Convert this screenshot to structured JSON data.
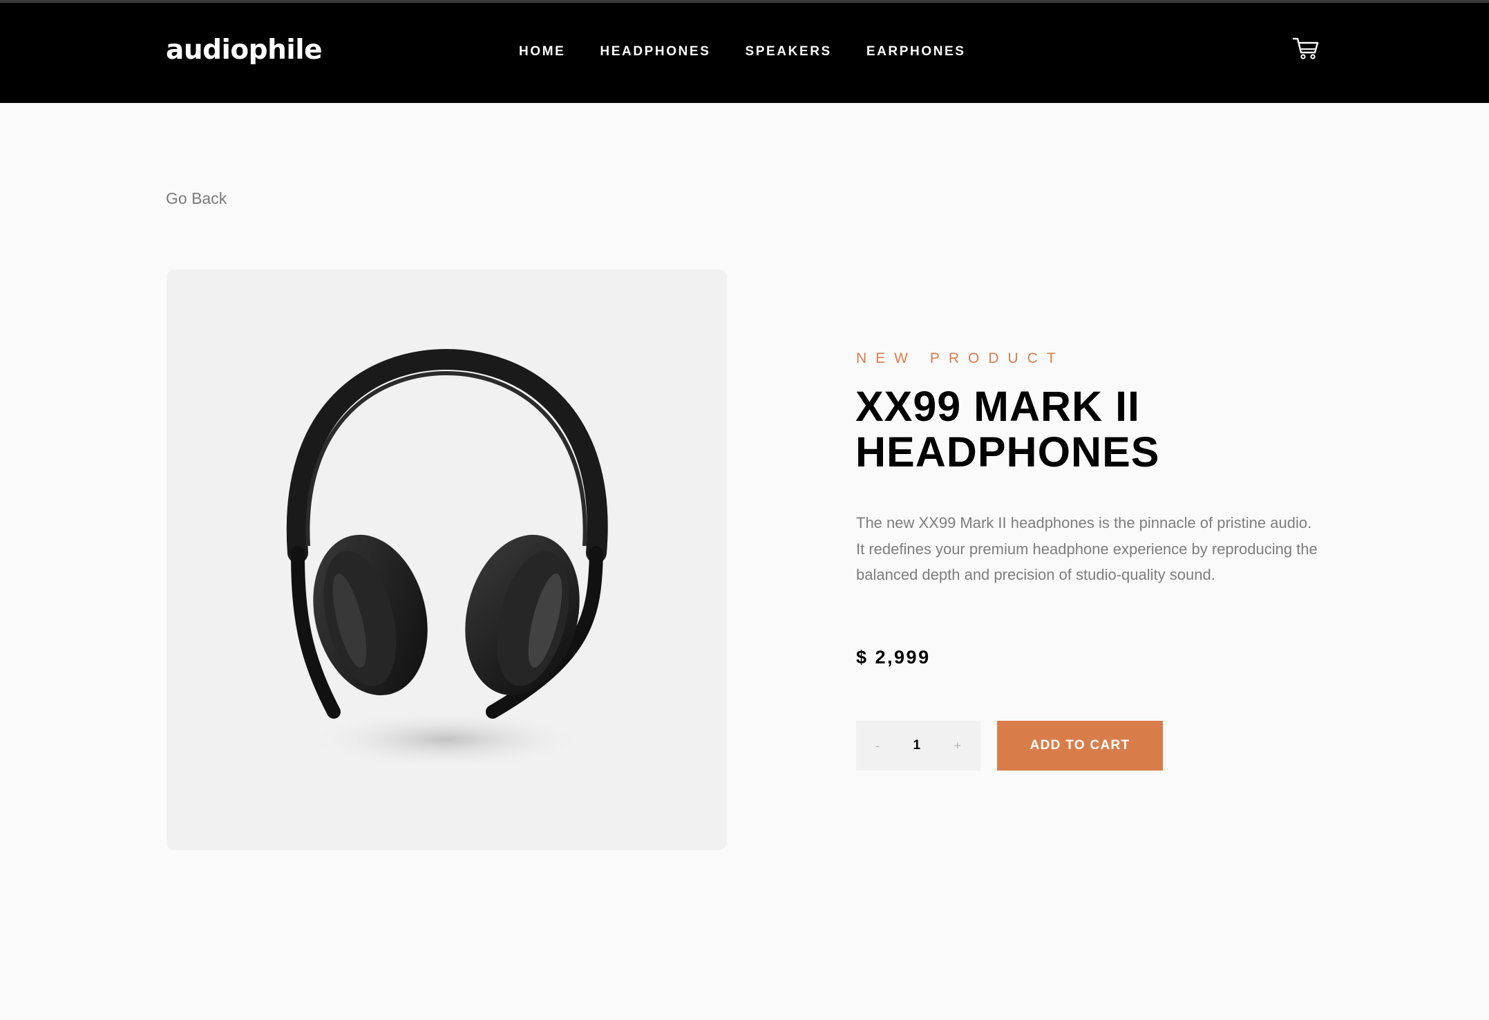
{
  "header": {
    "logo": "audiophile",
    "nav": [
      "HOME",
      "HEADPHONES",
      "SPEAKERS",
      "EARPHONES"
    ],
    "cart_icon": "cart-icon"
  },
  "page": {
    "go_back": "Go Back"
  },
  "product": {
    "overline": "NEW PRODUCT",
    "title_line1": "XX99 MARK II",
    "title_line2": "HEADPHONES",
    "description": "The new XX99 Mark II headphones is the pinnacle of pristine audio. It redefines your premium headphone experience by reproducing the balanced depth and precision of studio-quality sound.",
    "price": "$ 2,999",
    "quantity": {
      "minus": "-",
      "value": "1",
      "plus": "+"
    },
    "add_to_cart": "ADD TO CART"
  },
  "colors": {
    "accent": "#d87d4a",
    "header_bg": "#000000",
    "page_bg": "#fafafa",
    "image_bg": "#f1f1f1"
  }
}
